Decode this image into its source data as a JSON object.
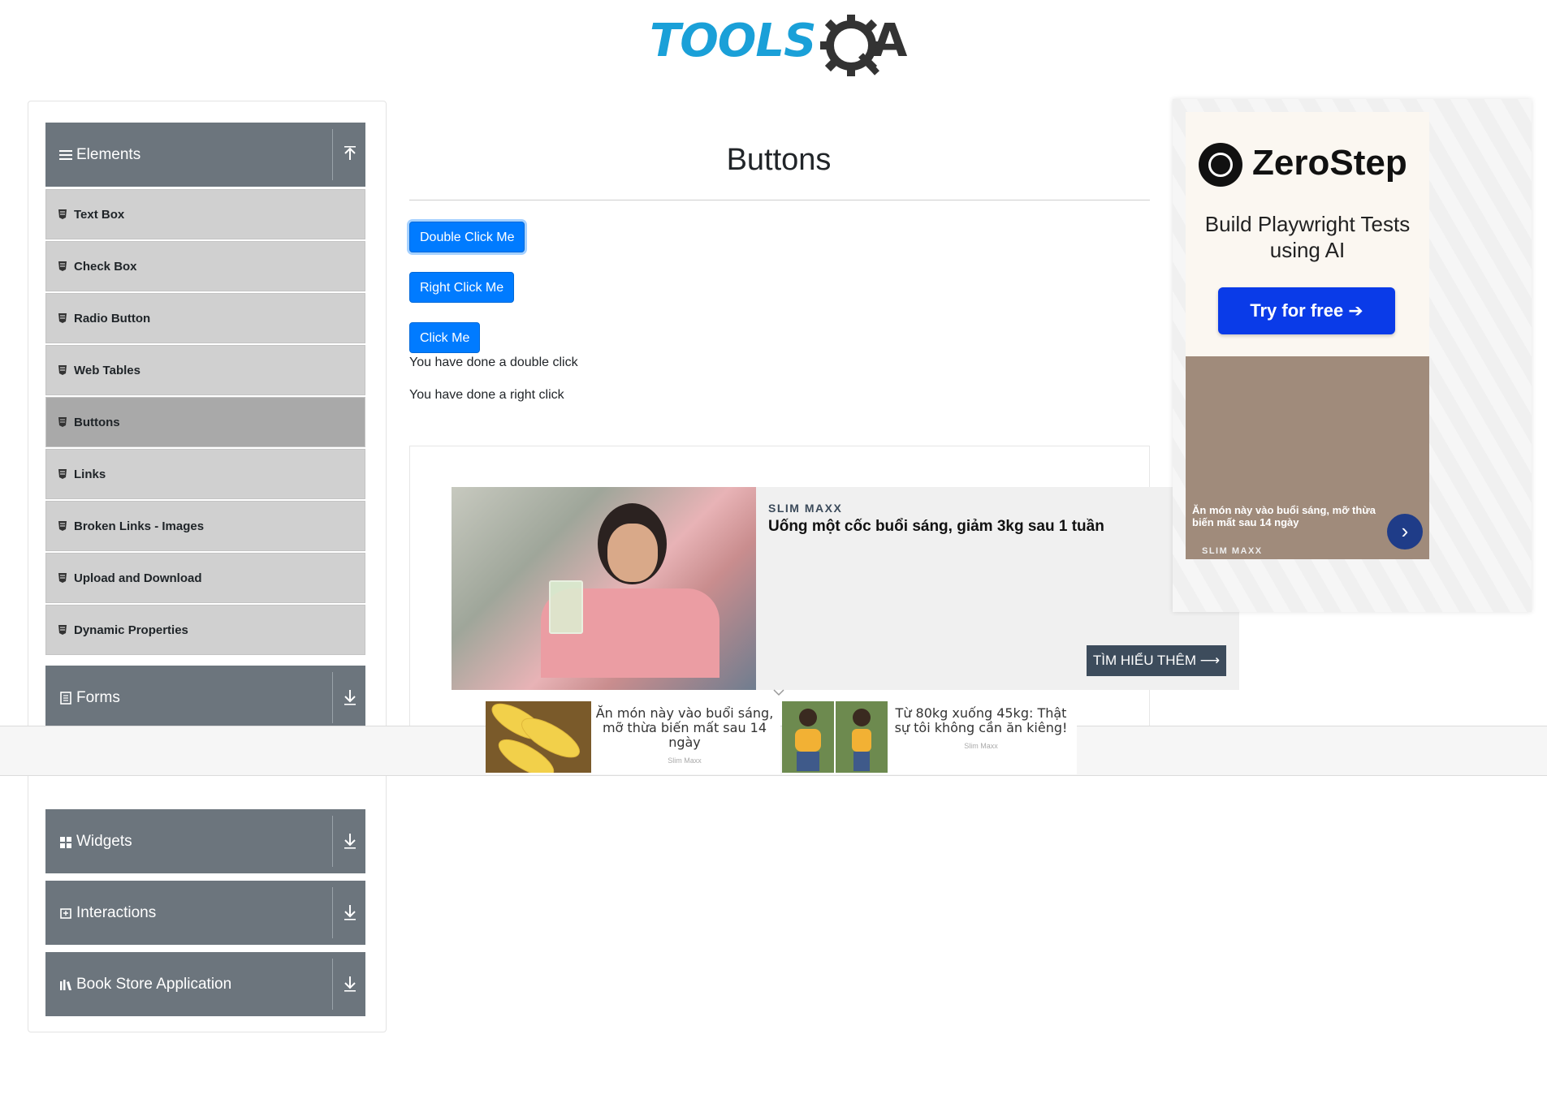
{
  "header": {
    "logo_tools": "TOOLS",
    "logo_qa": "QA"
  },
  "sidebar": {
    "groups": [
      {
        "label": "Elements",
        "icon": "hamburger-icon",
        "expanded": true
      },
      {
        "label": "Forms",
        "icon": "document-icon",
        "expanded": false
      },
      {
        "label": "Widgets",
        "icon": "grid-icon",
        "expanded": false
      },
      {
        "label": "Interactions",
        "icon": "interaction-icon",
        "expanded": false
      },
      {
        "label": "Book Store Application",
        "icon": "library-icon",
        "expanded": false
      }
    ],
    "items": [
      {
        "label": "Text Box"
      },
      {
        "label": "Check Box"
      },
      {
        "label": "Radio Button"
      },
      {
        "label": "Web Tables"
      },
      {
        "label": "Buttons",
        "active": true
      },
      {
        "label": "Links"
      },
      {
        "label": "Broken Links - Images"
      },
      {
        "label": "Upload and Download"
      },
      {
        "label": "Dynamic Properties"
      }
    ]
  },
  "main": {
    "title": "Buttons",
    "buttons": {
      "double_click": "Double Click Me",
      "right_click": "Right Click Me",
      "click": "Click Me"
    },
    "messages": {
      "double": "You have done a double click",
      "right": "You have done a right click"
    }
  },
  "ads": {
    "middle": {
      "brand": "SLIM MAXX",
      "headline": "Uống một cốc buổi sáng, giảm 3kg sau 1 tuần",
      "cta": "TÌM HIỂU THÊM ⟶"
    },
    "sticky": [
      {
        "text": "Ăn món này vào buổi sáng, mỡ thừa biến mất sau 14 ngày",
        "source": "Slim Maxx"
      },
      {
        "text": "Từ 80kg xuống 45kg: Thật sự tôi không cần ăn kiêng!",
        "source": "Slim Maxx"
      }
    ],
    "right": {
      "brand": "ZeroStep",
      "tagline": "Build Playwright Tests using AI",
      "cta": "Try for free ➔",
      "photo_caption": "Ăn món này vào buổi sáng, mỡ thừa biến mất sau 14 ngày",
      "photo_source": "SLIM MAXX"
    }
  },
  "colors": {
    "header_bg": "#6c757d",
    "item_bg": "#d0d0d0",
    "active_item_bg": "#a9a9a9",
    "primary_button": "#007bff",
    "logo_blue": "#1aa0d8"
  }
}
